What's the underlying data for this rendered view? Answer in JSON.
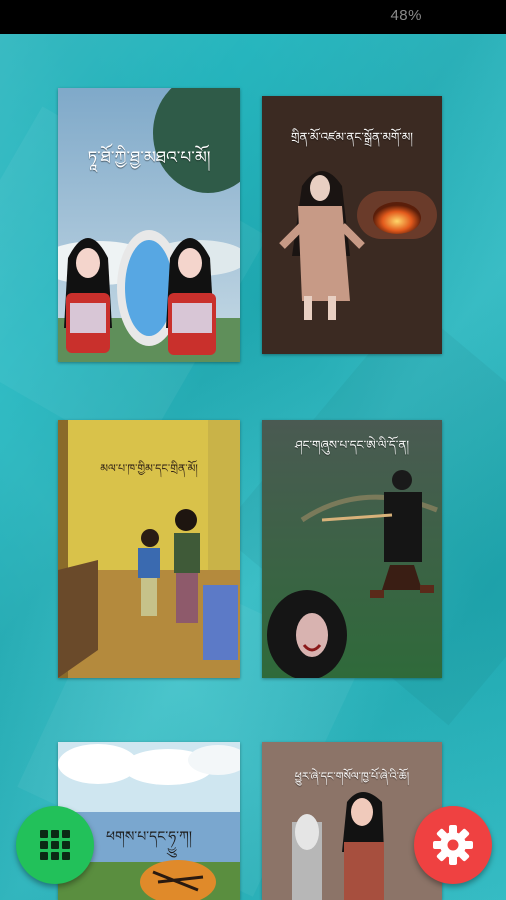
{
  "status_bar": {
    "battery_text": "48%"
  },
  "books": [
    {
      "title": "ཏཱ་ཐོ་ཀྱི་ཐྱ་མཐའ་པ་མོ།"
    },
    {
      "title": "གྲིན་མོ་འཛམ་ནང་སྒྲོན་མགོ་མ།"
    },
    {
      "title": "མལ་པ་ཁ་གྱིམ་དང་གྲིན་མོ།"
    },
    {
      "title": "ཤང་གཞུས་པ་དང་ཨེ་ལི་དོ་ན།"
    },
    {
      "title": "ཕགས་པ་དང་ཧྱུ་ཀ།"
    },
    {
      "title": "ཕྱུར་ཞེ་དང་གསོལ་ཁྱ་པོ་ཞེ་འི་ཆོ།"
    }
  ],
  "fab": {
    "grid_icon": "grid-icon",
    "settings_icon": "gear-icon",
    "grid_color": "#22c15a",
    "settings_color": "#ef4141"
  }
}
